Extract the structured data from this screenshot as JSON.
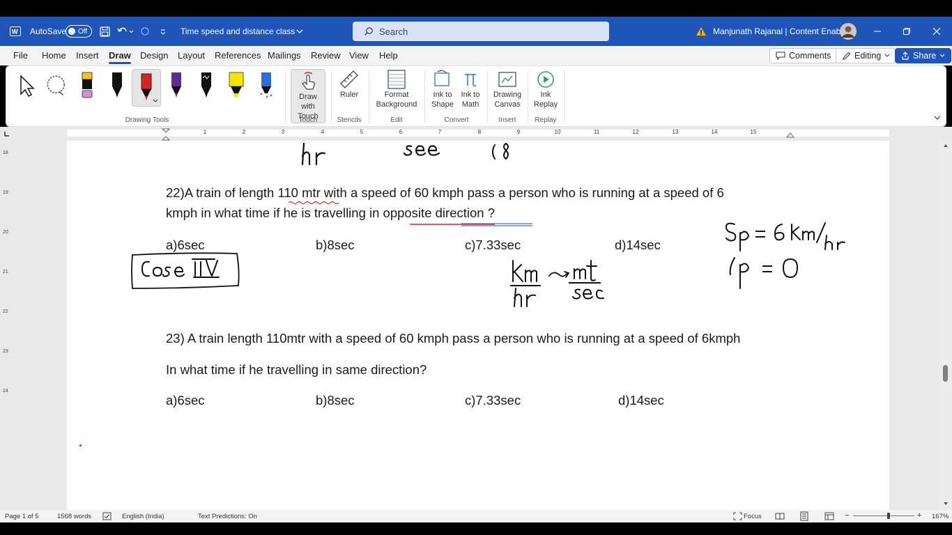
{
  "titlebar": {
    "autosave_label": "AutoSave",
    "autosave_state": "Off",
    "doc_title": "Time speed and distance class",
    "search_placeholder": "Search",
    "user_name": "Manjunath Rajanal | Content Enablers"
  },
  "menu": {
    "items": [
      "File",
      "Home",
      "Insert",
      "Draw",
      "Design",
      "Layout",
      "References",
      "Mailings",
      "Review",
      "View",
      "Help"
    ],
    "active": "Draw",
    "comments_label": "Comments",
    "editing_label": "Editing",
    "share_label": "Share"
  },
  "ribbon": {
    "buttons": {
      "draw_with_touch": "Draw with Touch",
      "ruler": "Ruler",
      "format_background": "Format Background",
      "ink_to_shape": "Ink to Shape",
      "ink_to_math": "Ink to Math",
      "drawing_canvas": "Drawing Canvas",
      "ink_replay": "Ink Replay"
    },
    "groups": {
      "drawing_tools": "Drawing Tools",
      "touch": "Touch",
      "stencils": "Stencils",
      "edit": "Edit",
      "convert": "Convert",
      "insert": "Insert",
      "replay": "Replay"
    },
    "pen_colors": [
      "#f5c518",
      "#111111",
      "#d92323",
      "#5b2d8e",
      "#111111",
      "#f2e600",
      "#2b6fd6"
    ]
  },
  "ruler": {
    "ticks": [
      "1",
      "2",
      "3",
      "4",
      "5",
      "6",
      "7",
      "8",
      "9",
      "10",
      "11",
      "12",
      "13",
      "14",
      "15"
    ],
    "vticks": [
      "18",
      "19",
      "20",
      "21",
      "22",
      "23",
      "24"
    ]
  },
  "document": {
    "q22_line1": "22)A train of length 110 mtr with a speed of 60 kmph pass a person who is running at a speed of 6",
    "q22_line2": "kmph in what time if he is travelling in opposite direction ?",
    "q22_options": [
      "a)6sec",
      "b)8sec",
      "c)7.33sec",
      "d)14sec"
    ],
    "q23_line1": "23) A train length 110mtr with a speed of 60 kmph pass a person who is running at a speed of 6kmph",
    "q23_line2": "In what time if he travelling in same direction?",
    "q23_options": [
      "a)6sec",
      "b)8sec",
      "c)7.33sec",
      "d)14sec"
    ],
    "handwriting": {
      "top_fragment_1": "hr",
      "top_fragment_2": "sec",
      "top_fragment_3": "(8",
      "case_label": "Case III",
      "unit_fraction_num": "km",
      "unit_fraction_den": "hr",
      "arrow_text": "mt",
      "unit_den_2": "sec",
      "sp_eq": "Sp = 6 km/hr",
      "lp_eq": "lp = 0"
    },
    "ink_color": "#111111"
  },
  "status": {
    "page": "Page 1 of 5",
    "words": "1568 words",
    "language": "English (India)",
    "predictions": "Text Predictions: On",
    "focus": "Focus",
    "zoom": "167%"
  }
}
